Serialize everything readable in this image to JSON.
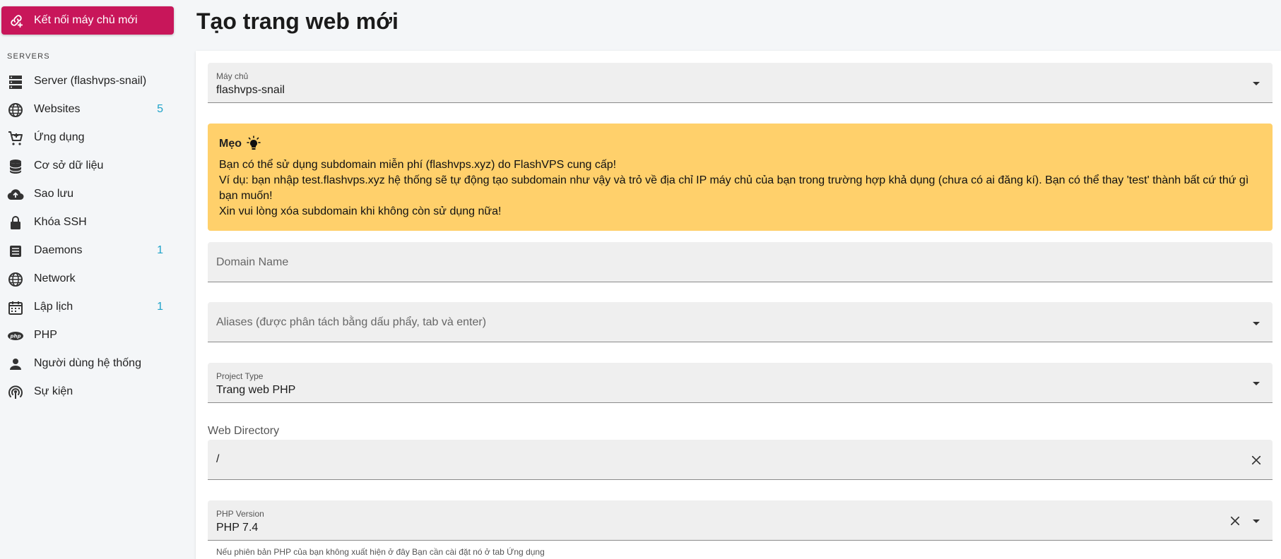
{
  "sidebar": {
    "connect_label": "Kết nối máy chủ mới",
    "section_title": "SERVERS",
    "items": [
      {
        "label": "Server (flashvps-snail)",
        "icon": "server-icon",
        "count": ""
      },
      {
        "label": "Websites",
        "icon": "globe-icon",
        "count": "5"
      },
      {
        "label": "Ứng dụng",
        "icon": "cart-icon",
        "count": ""
      },
      {
        "label": "Cơ sở dữ liệu",
        "icon": "database-icon",
        "count": ""
      },
      {
        "label": "Sao lưu",
        "icon": "cloud-upload-icon",
        "count": ""
      },
      {
        "label": "Khóa SSH",
        "icon": "lock-icon",
        "count": ""
      },
      {
        "label": "Daemons",
        "icon": "daemon-icon",
        "count": "1"
      },
      {
        "label": "Network",
        "icon": "globe-icon",
        "count": ""
      },
      {
        "label": "Lập lịch",
        "icon": "calendar-icon",
        "count": "1"
      },
      {
        "label": "PHP",
        "icon": "php-icon",
        "count": ""
      },
      {
        "label": "Người dùng hệ thống",
        "icon": "person-icon",
        "count": ""
      },
      {
        "label": "Sự kiện",
        "icon": "broadcast-icon",
        "count": ""
      }
    ]
  },
  "main": {
    "title": "Tạo trang web mới",
    "server_field": {
      "label": "Máy chủ",
      "value": "flashvps-snail"
    },
    "tip": {
      "title": "Mẹo",
      "line1": "Bạn có thể sử dụng subdomain miễn phí (flashvps.xyz) do FlashVPS cung cấp!",
      "line2": "Ví dụ: bạn nhập test.flashvps.xyz hệ thống sẽ tự động tạo subdomain như vậy và trỏ về địa chỉ IP máy chủ của bạn trong trường hợp khả dụng (chưa có ai đăng kí). Bạn có thể thay 'test' thành bất cứ thứ gì bạn muốn!",
      "line3": "Xin vui lòng xóa subdomain khi không còn sử dụng nữa!"
    },
    "domain_field": {
      "placeholder": "Domain Name"
    },
    "aliases_field": {
      "placeholder": "Aliases (được phân tách bằng dấu phẩy, tab và enter)"
    },
    "project_type_field": {
      "label": "Project Type",
      "value": "Trang web PHP"
    },
    "web_directory": {
      "label": "Web Directory",
      "value": "/"
    },
    "php_version_field": {
      "label": "PHP Version",
      "value": "PHP 7.4"
    },
    "php_hint": "Nếu phiên bản PHP của bạn không xuất hiện ở đây Bạn cần cài đặt nó ở tab Ứng dụng"
  },
  "colors": {
    "accent": "#c8165a",
    "tip_bg": "#ffd06b",
    "count": "#1fa3c9"
  }
}
